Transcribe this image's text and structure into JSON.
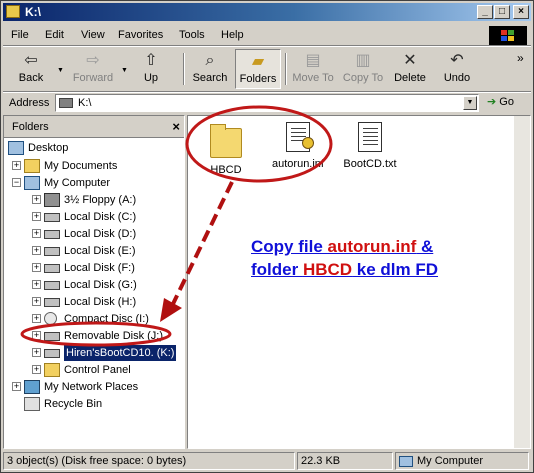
{
  "window": {
    "title": "K:\\"
  },
  "title_buttons": {
    "minimize": "_",
    "maximize": "□",
    "close": "×"
  },
  "menu": [
    "File",
    "Edit",
    "View",
    "Favorites",
    "Tools",
    "Help"
  ],
  "toolbar": {
    "back": "Back",
    "forward": "Forward",
    "up": "Up",
    "search": "Search",
    "folders": "Folders",
    "move_to": "Move To",
    "copy_to": "Copy To",
    "delete": "Delete",
    "undo": "Undo",
    "overflow": "»"
  },
  "address": {
    "label": "Address",
    "value": "K:\\",
    "go": "Go"
  },
  "folders_pane": {
    "header": "Folders",
    "close": "×",
    "items": [
      {
        "label": "Desktop",
        "icon": "desktop-icon"
      },
      {
        "label": "My Documents",
        "icon": "folder-icon"
      },
      {
        "label": "My Computer",
        "icon": "computer-icon"
      },
      {
        "label": "3½ Floppy (A:)",
        "icon": "floppy-icon"
      },
      {
        "label": "Local Disk (C:)",
        "icon": "drive-icon"
      },
      {
        "label": "Local Disk (D:)",
        "icon": "drive-icon"
      },
      {
        "label": "Local Disk (E:)",
        "icon": "drive-icon"
      },
      {
        "label": "Local Disk (F:)",
        "icon": "drive-icon"
      },
      {
        "label": "Local Disk (G:)",
        "icon": "drive-icon"
      },
      {
        "label": "Local Disk (H:)",
        "icon": "drive-icon"
      },
      {
        "label": "Compact Disc (I:)",
        "icon": "cd-icon"
      },
      {
        "label": "Removable Disk (J:)",
        "icon": "drive-icon"
      },
      {
        "label": "Hiren'sBootCD10. (K:)",
        "icon": "drive-icon"
      },
      {
        "label": "Control Panel",
        "icon": "control-panel-icon"
      },
      {
        "label": "My Network Places",
        "icon": "network-icon"
      },
      {
        "label": "Recycle Bin",
        "icon": "recycle-bin-icon"
      }
    ]
  },
  "files": [
    {
      "name": "HBCD",
      "icon": "folder-icon"
    },
    {
      "name": "autorun.inf",
      "icon": "settings-file-icon"
    },
    {
      "name": "BootCD.txt",
      "icon": "text-file-icon"
    }
  ],
  "annotation": {
    "line1_a": "Copy file ",
    "line1_b": "autorun.inf",
    "line1_c": " &",
    "line2_a": "folder ",
    "line2_b": "HBCD",
    "line2_c": " ke dlm FD",
    "color_highlight": "#d01010",
    "color_text": "#1010d8"
  },
  "statusbar": {
    "objects": "3 object(s) (Disk free space: 0 bytes)",
    "size": "22.3 KB",
    "location": "My Computer"
  }
}
